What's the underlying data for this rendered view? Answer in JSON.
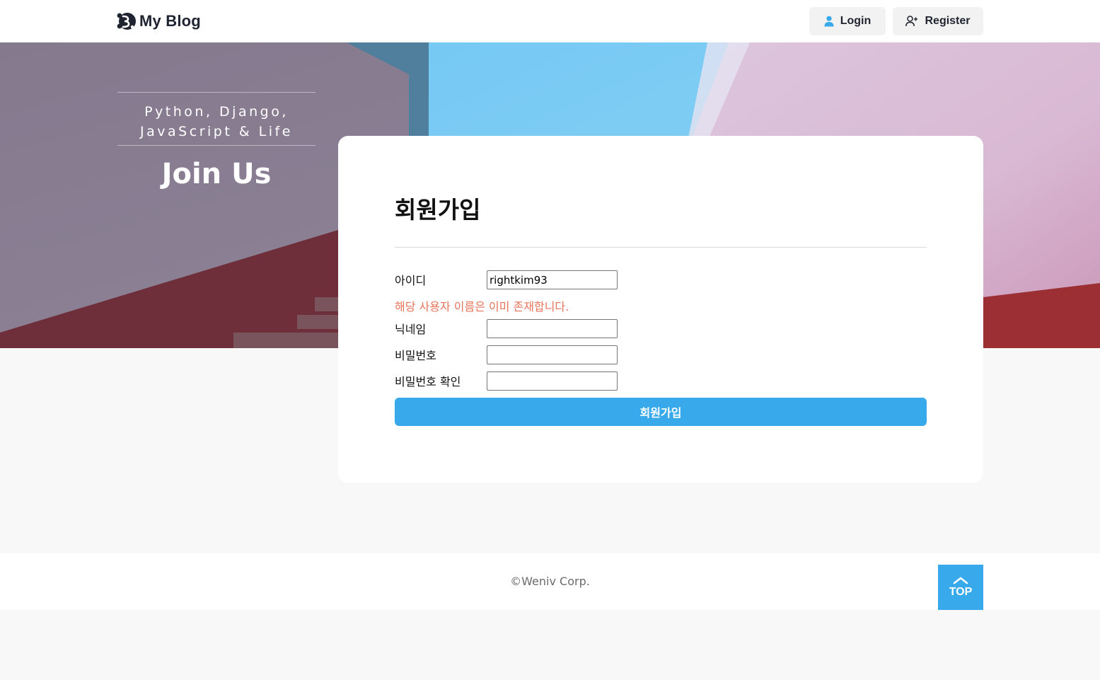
{
  "header": {
    "brand": "My Blog",
    "login_label": "Login",
    "register_label": "Register"
  },
  "hero": {
    "tagline_line1": "Python, Django,",
    "tagline_line2": "JavaScript & Life",
    "title": "Join Us"
  },
  "form": {
    "title": "회원가입",
    "fields": [
      {
        "label": "아이디",
        "value": "rightkim93"
      },
      {
        "label": "닉네임",
        "value": ""
      },
      {
        "label": "비밀번호",
        "value": ""
      },
      {
        "label": "비밀번호 확인",
        "value": ""
      }
    ],
    "error": "해당 사용자 이름은 이미 존재합니다.",
    "submit_label": "회원가입"
  },
  "footer": {
    "copyright": "©Weniv Corp.",
    "top_label": "TOP"
  },
  "colors": {
    "accent": "#38a9eb",
    "error": "#e8745a",
    "page_bg": "#f8f8f8"
  },
  "icons": [
    "logo-icon",
    "user-icon",
    "user-plus-icon",
    "chevron-up-icon"
  ]
}
